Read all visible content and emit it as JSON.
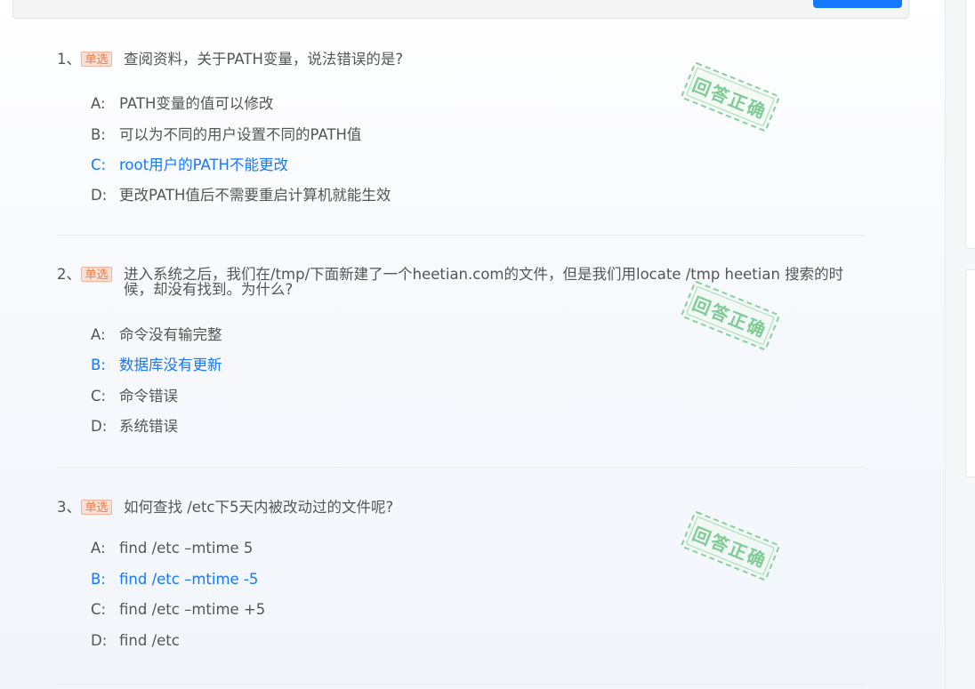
{
  "stamp_text": "回答正确",
  "questions": [
    {
      "num": "1、",
      "badge": "单选",
      "text": "查阅资料，关于PATH变量，说法错误的是?",
      "options": [
        {
          "key": "A:",
          "text": "PATH变量的值可以修改",
          "correct": false
        },
        {
          "key": "B:",
          "text": "可以为不同的用户设置不同的PATH值",
          "correct": false
        },
        {
          "key": "C:",
          "text": "root用户的PATH不能更改",
          "correct": true
        },
        {
          "key": "D:",
          "text": "更改PATH值后不需要重启计算机就能生效",
          "correct": false
        }
      ]
    },
    {
      "num": "2、",
      "badge": "单选",
      "text": "进入系统之后，我们在/tmp/下面新建了一个heetian.com的文件，但是我们用locate /tmp heetian 搜索的时候，却没有找到。为什么?",
      "options": [
        {
          "key": "A:",
          "text": "命令没有输完整",
          "correct": false
        },
        {
          "key": "B:",
          "text": "数据库没有更新",
          "correct": true
        },
        {
          "key": "C:",
          "text": "命令错误",
          "correct": false
        },
        {
          "key": "D:",
          "text": "系统错误",
          "correct": false
        }
      ]
    },
    {
      "num": "3、",
      "badge": "单选",
      "text": "如何查找 /etc下5天内被改动过的文件呢?",
      "options": [
        {
          "key": "A:",
          "text": "find /etc –mtime 5",
          "correct": false
        },
        {
          "key": "B:",
          "text": "find /etc –mtime -5",
          "correct": true
        },
        {
          "key": "C:",
          "text": "find /etc –mtime +5",
          "correct": false
        },
        {
          "key": "D:",
          "text": "find /etc",
          "correct": false
        }
      ]
    }
  ],
  "colors": {
    "correct": "#1677ff",
    "text": "#555555",
    "badge_bg": "#fde0d4",
    "stamp": "#7fcb95"
  }
}
